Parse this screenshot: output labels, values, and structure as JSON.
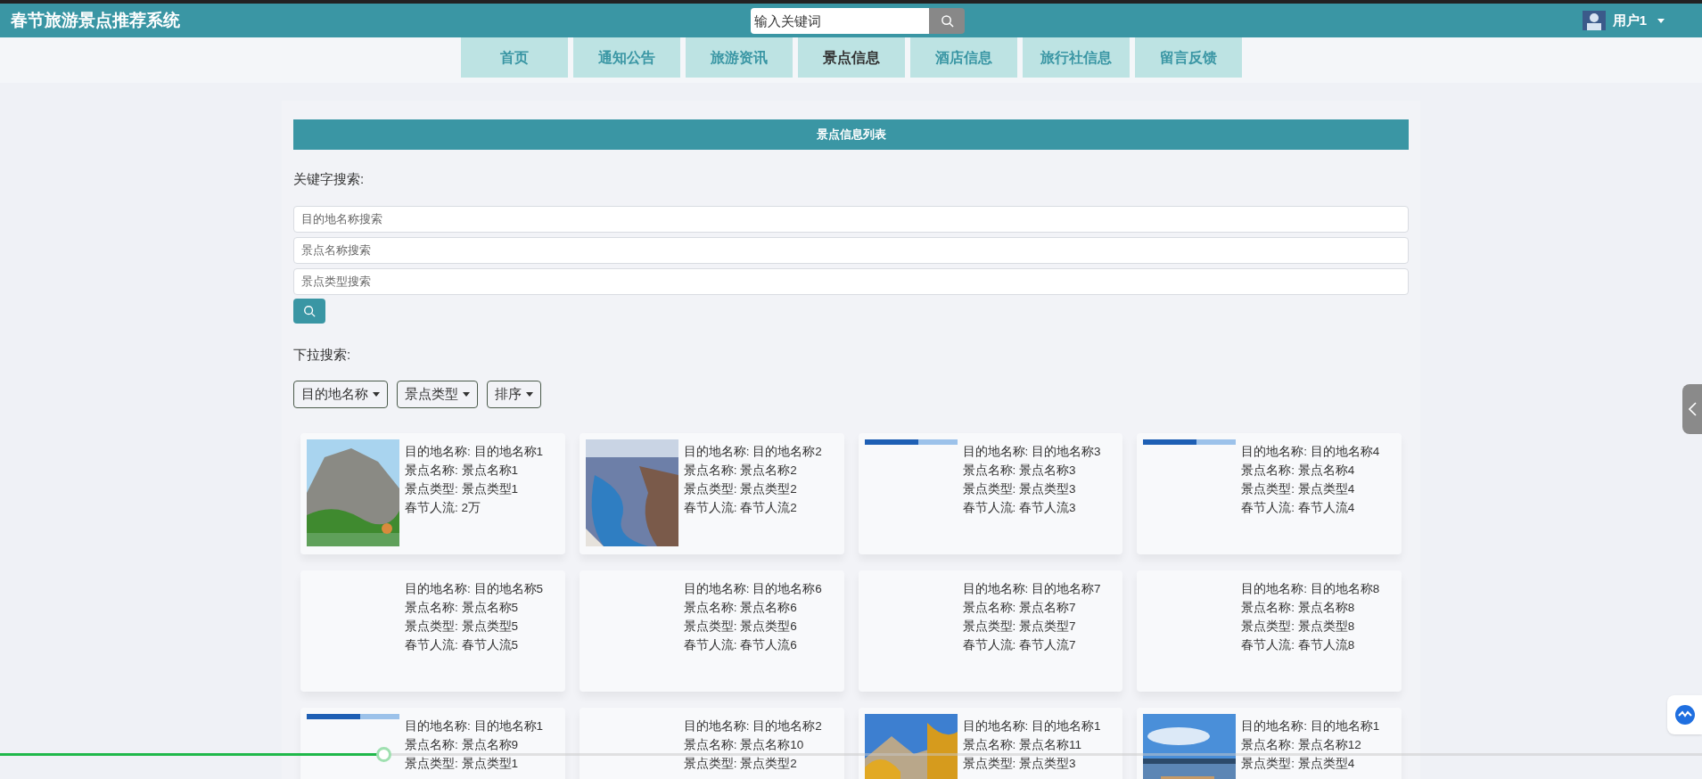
{
  "header": {
    "title": "春节旅游景点推荐系统",
    "search": {
      "placeholder": "输入关键词"
    },
    "user": "用户1"
  },
  "nav": [
    {
      "label": "首页",
      "selected": false
    },
    {
      "label": "通知公告",
      "selected": false
    },
    {
      "label": "旅游资讯",
      "selected": false
    },
    {
      "label": "景点信息",
      "selected": true
    },
    {
      "label": "酒店信息",
      "selected": false
    },
    {
      "label": "旅行社信息",
      "selected": false
    },
    {
      "label": "留言反馈",
      "selected": false
    }
  ],
  "panel_title": "景点信息列表",
  "keyword_label": "关键字搜索:",
  "keyword_fields": [
    {
      "placeholder": "目的地名称搜索"
    },
    {
      "placeholder": "景点名称搜索"
    },
    {
      "placeholder": "景点类型搜索"
    }
  ],
  "dropdown_label": "下拉搜索:",
  "dropdowns": [
    "目的地名称",
    "景点类型",
    "排序"
  ],
  "cards": [
    {
      "kind": "picture",
      "lines": [
        "目的地名称: 目的地名称1",
        "景点名称: 景点名称1",
        "景点类型: 景点类型1",
        "春节人流: 2万"
      ]
    },
    {
      "kind": "picture",
      "lines": [
        "目的地名称: 目的地名称2",
        "景点名称: 景点名称2",
        "景点类型: 景点类型2",
        "春节人流: 春节人流2"
      ]
    },
    {
      "kind": "picture",
      "lines": [
        "目的地名称: 目的地名称3",
        "景点名称: 景点名称3",
        "景点类型: 景点类型3",
        "春节人流: 春节人流3"
      ]
    },
    {
      "kind": "picture",
      "lines": [
        "目的地名称: 目的地名称4",
        "景点名称: 景点名称4",
        "景点类型: 景点类型4",
        "春节人流: 春节人流4"
      ]
    },
    {
      "lines": [
        "目的地名称: 目的地名称5",
        "景点名称: 景点名称5",
        "景点类型: 景点类型5",
        "春节人流: 春节人流5"
      ]
    },
    {
      "lines": [
        "目的地名称: 目的地名称6",
        "景点名称: 景点名称6",
        "景点类型: 景点类型6",
        "春节人流: 春节人流6"
      ]
    },
    {
      "lines": [
        "目的地名称: 目的地名称7",
        "景点名称: 景点名称7",
        "景点类型: 景点类型7",
        "春节人流: 春节人流7"
      ]
    },
    {
      "lines": [
        "目的地名称: 目的地名称8",
        "景点名称: 景点名称8",
        "景点类型: 景点类型8",
        "春节人流: 春节人流8"
      ]
    },
    {
      "kind": "picture",
      "lines": [
        "目的地名称: 目的地名称1",
        "景点名称: 景点名称9",
        "景点类型: 景点类型1"
      ]
    },
    {
      "lines": [
        "目的地名称: 目的地名称2",
        "景点名称: 景点名称10",
        "景点类型: 景点类型2"
      ]
    },
    {
      "kind": "picture",
      "lines": [
        "目的地名称: 目的地名称1",
        "景点名称: 景点名称11",
        "景点类型: 景点类型3"
      ]
    },
    {
      "kind": "picture",
      "lines": [
        "目的地名称: 目的地名称1",
        "景点名称: 景点名称12",
        "景点类型: 景点类型4"
      ]
    }
  ],
  "video_progress": {
    "level": 0.225
  }
}
